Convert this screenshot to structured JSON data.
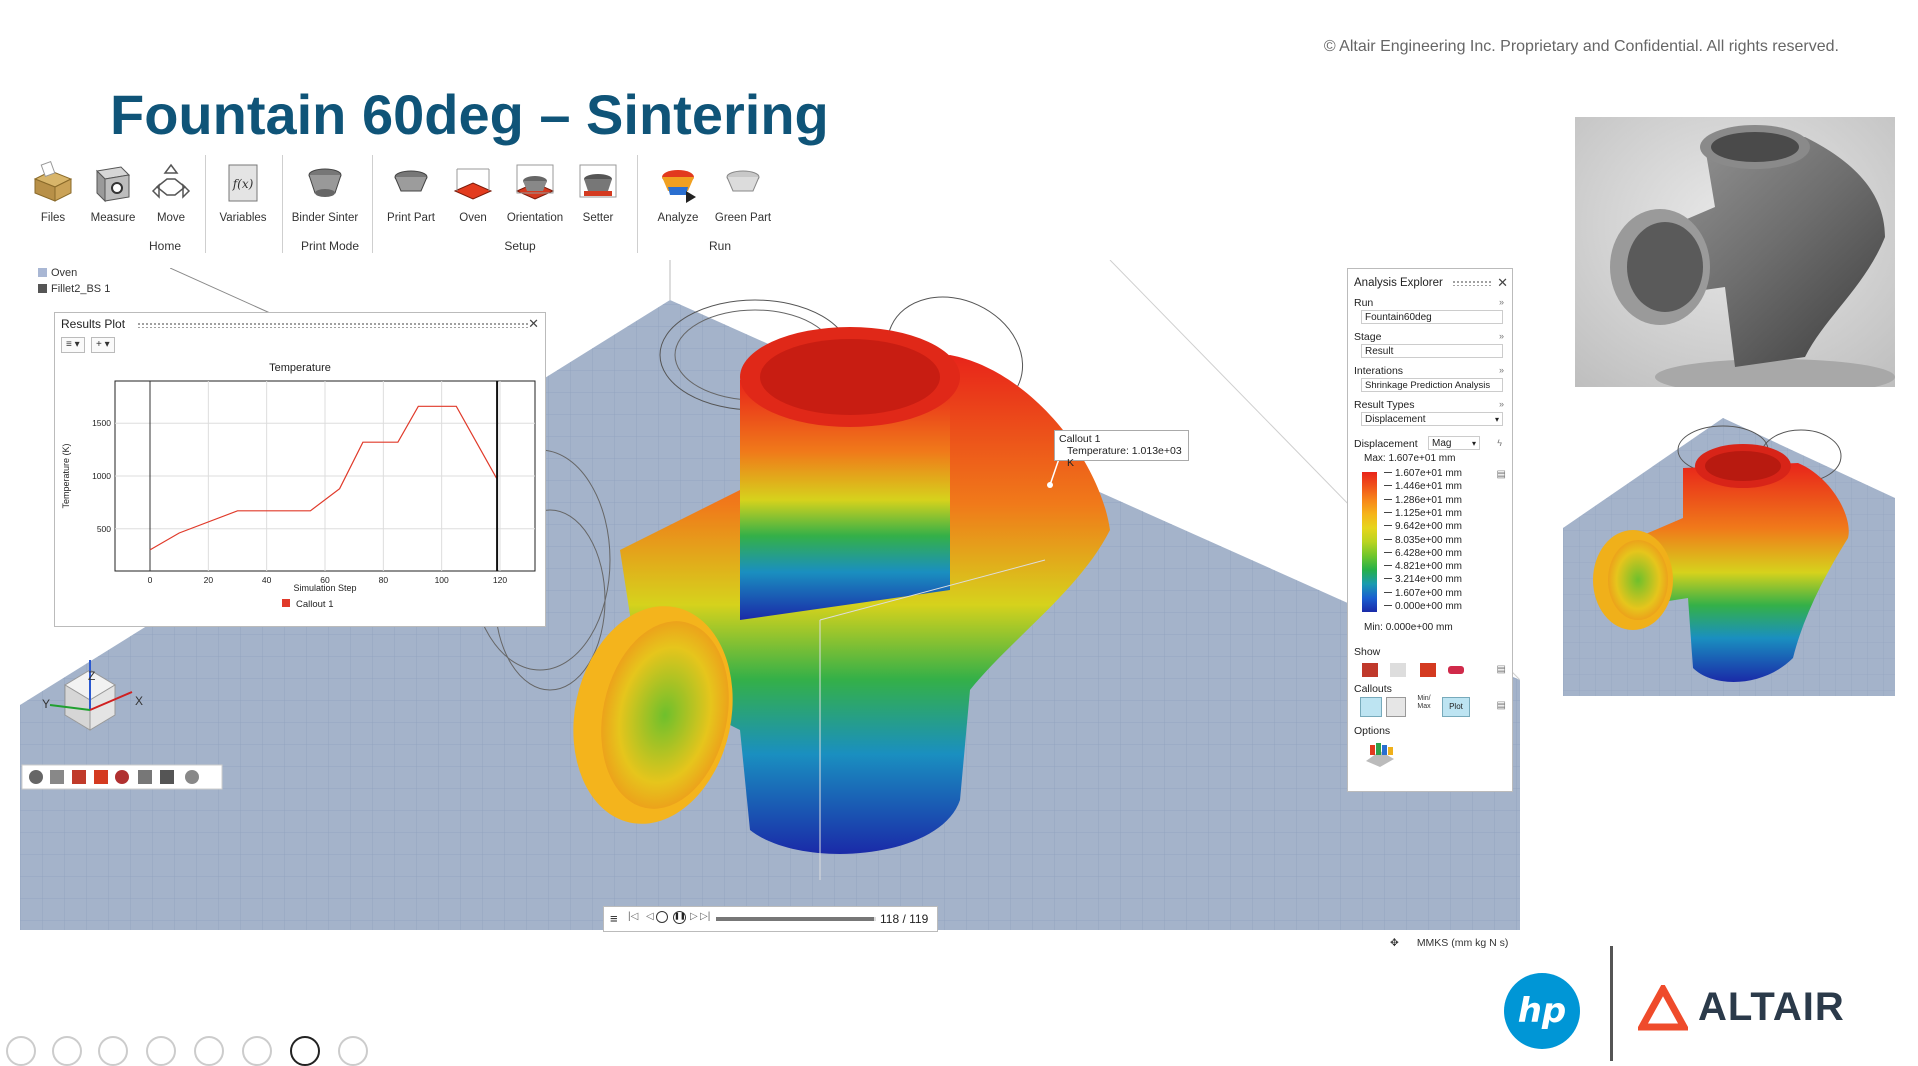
{
  "copyright": "© Altair Engineering Inc. Proprietary and Confidential. All rights reserved.",
  "slide_title": "Fountain 60deg – Sintering",
  "ribbon": {
    "tools": [
      {
        "label": "Files",
        "icon": "files-icon"
      },
      {
        "label": "Measure",
        "icon": "measure-icon"
      },
      {
        "label": "Move",
        "icon": "move-icon"
      },
      {
        "label": "Variables",
        "icon": "variables-icon"
      },
      {
        "label": "Binder Sinter",
        "icon": "binder-sinter-icon"
      },
      {
        "label": "Print Part",
        "icon": "print-part-icon"
      },
      {
        "label": "Oven",
        "icon": "oven-icon"
      },
      {
        "label": "Orientation",
        "icon": "orientation-icon"
      },
      {
        "label": "Setter",
        "icon": "setter-icon"
      },
      {
        "label": "Analyze",
        "icon": "analyze-icon"
      },
      {
        "label": "Green Part",
        "icon": "green-part-icon"
      }
    ],
    "groups": [
      "Home",
      "Print Mode",
      "Setup",
      "Run"
    ],
    "function_symbol": "f(x)"
  },
  "model_tree": [
    "Oven",
    "Fillet2_BS 1"
  ],
  "results_plot": {
    "panel_title": "Results Plot",
    "menu_glyph": "≡ ▾",
    "add_glyph": "+ ▾"
  },
  "chart_data": {
    "type": "line",
    "title": "Temperature",
    "xlabel": "Simulation Step",
    "ylabel": "Temperature (K)",
    "xlim": [
      -12,
      132
    ],
    "ylim": [
      100,
      1900
    ],
    "xticks": [
      0,
      20,
      40,
      60,
      80,
      100,
      120
    ],
    "yticks": [
      500,
      1000,
      1500
    ],
    "series": [
      {
        "name": "Callout 1",
        "color": "#e03a2a",
        "x": [
          0,
          10,
          30,
          55,
          65,
          73,
          85,
          92,
          105,
          119
        ],
        "y": [
          300,
          460,
          670,
          670,
          880,
          1320,
          1320,
          1660,
          1660,
          970
        ]
      }
    ],
    "cursor_x": 119
  },
  "callout": {
    "title": "Callout 1",
    "text": "Temperature: 1.013e+03 K"
  },
  "explorer": {
    "title": "Analysis Explorer",
    "run_label": "Run",
    "run_value": "Fountain60deg",
    "stage_label": "Stage",
    "stage_value": "Result",
    "iter_label": "Interations",
    "iter_value": "Shrinkage Prediction Analysis",
    "result_types_label": "Result Types",
    "result_types_value": "Displacement",
    "disp_label": "Displacement",
    "disp_mode": "Mag",
    "max_label": "Max:",
    "max_value": "1.607e+01 mm",
    "min_label": "Min:",
    "min_value": "0.000e+00 mm",
    "legend": [
      {
        "value": "1.607e+01 mm",
        "color": "#e8241a"
      },
      {
        "value": "1.446e+01 mm",
        "color": "#f0521a"
      },
      {
        "value": "1.286e+01 mm",
        "color": "#f7861a"
      },
      {
        "value": "1.125e+01 mm",
        "color": "#f6b41a"
      },
      {
        "value": "9.642e+00 mm",
        "color": "#e6d51c"
      },
      {
        "value": "8.035e+00 mm",
        "color": "#b9d421"
      },
      {
        "value": "6.428e+00 mm",
        "color": "#6fc62c"
      },
      {
        "value": "4.821e+00 mm",
        "color": "#25b04a"
      },
      {
        "value": "3.214e+00 mm",
        "color": "#1a9bb0"
      },
      {
        "value": "1.607e+00 mm",
        "color": "#1a5fd0"
      },
      {
        "value": "0.000e+00 mm",
        "color": "#1a2aa8"
      }
    ],
    "show_label": "Show",
    "callouts_label": "Callouts",
    "minmax_label": "Min/ Max",
    "plot_label": "Plot",
    "options_label": "Options"
  },
  "playback": {
    "frame": "118 / 119",
    "progress": 0.99
  },
  "units": "MMKS (mm kg N s)",
  "axes": {
    "x": "X",
    "y": "Y",
    "z": "Z"
  },
  "logos": {
    "hp": "hp",
    "altair": "ALTAIR"
  }
}
